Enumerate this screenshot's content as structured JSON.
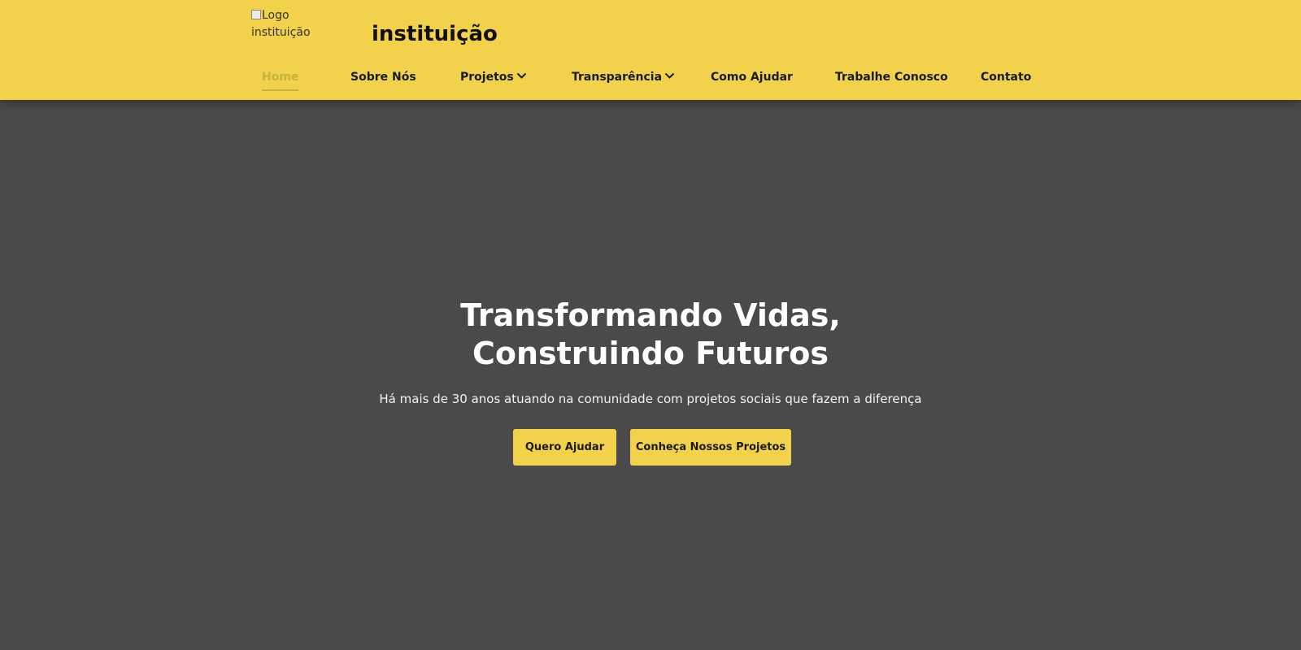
{
  "header": {
    "logo_alt": "Logo instituição",
    "title": "instituição",
    "background_color": "#f2d24a"
  },
  "nav": {
    "items": [
      {
        "label": "Home",
        "active": true
      },
      {
        "label": "Sobre Nós"
      },
      {
        "label": "Projetos",
        "icon": "chevron-down-icon"
      },
      {
        "label": "Transparência",
        "icon": "chevron-down-icon"
      },
      {
        "label": "Como Ajudar"
      },
      {
        "label": "Trabalhe Conosco"
      },
      {
        "label": "Contato"
      }
    ],
    "active_color": "#c9b13d"
  },
  "hero": {
    "title_line1": "Transformando Vidas,",
    "title_line2": "Construindo Futuros",
    "subtitle": "Há mais de 30 anos atuando na comunidade com projetos sociais que fazem a diferença",
    "buttons": {
      "help": "Quero Ajudar",
      "projects": "Conheça Nossos Projetos"
    },
    "background_color": "#4a4a4a"
  }
}
